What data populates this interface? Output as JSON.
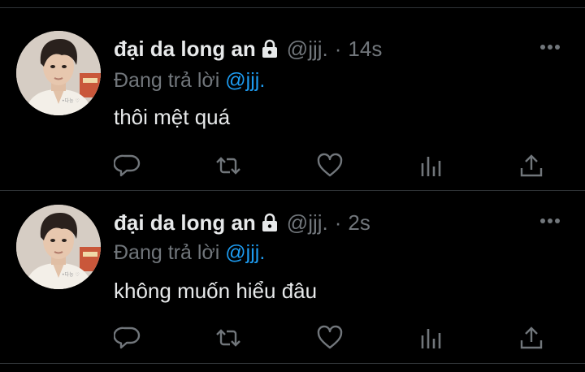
{
  "colors": {
    "background": "#000000",
    "text_primary": "#e7e9ea",
    "text_secondary": "#71767b",
    "accent": "#1d9bf0",
    "divider": "#2f3336"
  },
  "tweets": [
    {
      "display_name": "đại da long an",
      "handle": "@jjj.",
      "separator": "·",
      "time": "14s",
      "reply_prefix": "Đang trả lời",
      "reply_handle": "@jjj.",
      "text": "thôi mệt quá",
      "icons": [
        "avatar",
        "lock-icon",
        "more-icon",
        "reply-icon",
        "retweet-icon",
        "like-icon",
        "views-icon",
        "share-icon"
      ]
    },
    {
      "display_name": "đại da long an",
      "handle": "@jjj.",
      "separator": "·",
      "time": "2s",
      "reply_prefix": "Đang trả lời",
      "reply_handle": "@jjj.",
      "text": "không muốn hiểu đâu",
      "icons": [
        "avatar",
        "lock-icon",
        "more-icon",
        "reply-icon",
        "retweet-icon",
        "like-icon",
        "views-icon",
        "share-icon"
      ]
    }
  ]
}
